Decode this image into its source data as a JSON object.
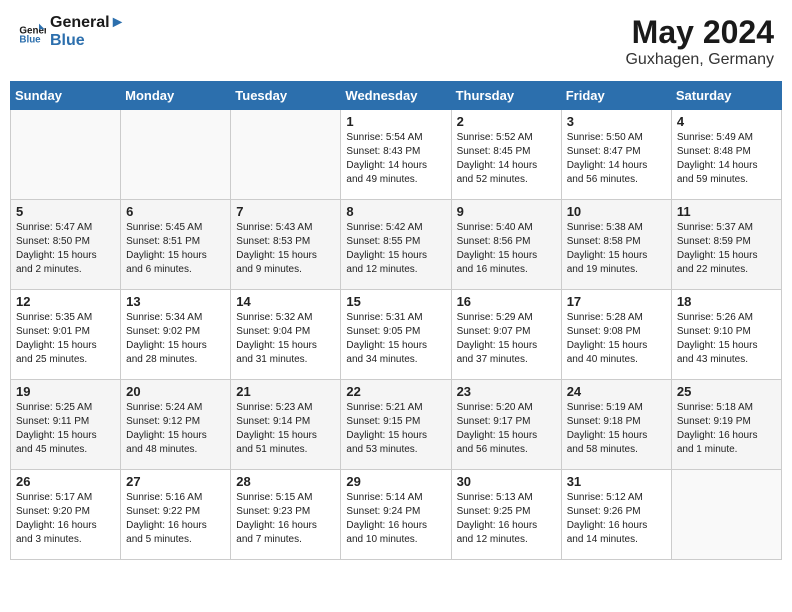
{
  "header": {
    "logo_line1": "General",
    "logo_line2": "Blue",
    "month": "May 2024",
    "location": "Guxhagen, Germany"
  },
  "weekdays": [
    "Sunday",
    "Monday",
    "Tuesday",
    "Wednesday",
    "Thursday",
    "Friday",
    "Saturday"
  ],
  "weeks": [
    [
      {
        "day": "",
        "sunrise": "",
        "sunset": "",
        "daylight": ""
      },
      {
        "day": "",
        "sunrise": "",
        "sunset": "",
        "daylight": ""
      },
      {
        "day": "",
        "sunrise": "",
        "sunset": "",
        "daylight": ""
      },
      {
        "day": "1",
        "sunrise": "Sunrise: 5:54 AM",
        "sunset": "Sunset: 8:43 PM",
        "daylight": "Daylight: 14 hours and 49 minutes."
      },
      {
        "day": "2",
        "sunrise": "Sunrise: 5:52 AM",
        "sunset": "Sunset: 8:45 PM",
        "daylight": "Daylight: 14 hours and 52 minutes."
      },
      {
        "day": "3",
        "sunrise": "Sunrise: 5:50 AM",
        "sunset": "Sunset: 8:47 PM",
        "daylight": "Daylight: 14 hours and 56 minutes."
      },
      {
        "day": "4",
        "sunrise": "Sunrise: 5:49 AM",
        "sunset": "Sunset: 8:48 PM",
        "daylight": "Daylight: 14 hours and 59 minutes."
      }
    ],
    [
      {
        "day": "5",
        "sunrise": "Sunrise: 5:47 AM",
        "sunset": "Sunset: 8:50 PM",
        "daylight": "Daylight: 15 hours and 2 minutes."
      },
      {
        "day": "6",
        "sunrise": "Sunrise: 5:45 AM",
        "sunset": "Sunset: 8:51 PM",
        "daylight": "Daylight: 15 hours and 6 minutes."
      },
      {
        "day": "7",
        "sunrise": "Sunrise: 5:43 AM",
        "sunset": "Sunset: 8:53 PM",
        "daylight": "Daylight: 15 hours and 9 minutes."
      },
      {
        "day": "8",
        "sunrise": "Sunrise: 5:42 AM",
        "sunset": "Sunset: 8:55 PM",
        "daylight": "Daylight: 15 hours and 12 minutes."
      },
      {
        "day": "9",
        "sunrise": "Sunrise: 5:40 AM",
        "sunset": "Sunset: 8:56 PM",
        "daylight": "Daylight: 15 hours and 16 minutes."
      },
      {
        "day": "10",
        "sunrise": "Sunrise: 5:38 AM",
        "sunset": "Sunset: 8:58 PM",
        "daylight": "Daylight: 15 hours and 19 minutes."
      },
      {
        "day": "11",
        "sunrise": "Sunrise: 5:37 AM",
        "sunset": "Sunset: 8:59 PM",
        "daylight": "Daylight: 15 hours and 22 minutes."
      }
    ],
    [
      {
        "day": "12",
        "sunrise": "Sunrise: 5:35 AM",
        "sunset": "Sunset: 9:01 PM",
        "daylight": "Daylight: 15 hours and 25 minutes."
      },
      {
        "day": "13",
        "sunrise": "Sunrise: 5:34 AM",
        "sunset": "Sunset: 9:02 PM",
        "daylight": "Daylight: 15 hours and 28 minutes."
      },
      {
        "day": "14",
        "sunrise": "Sunrise: 5:32 AM",
        "sunset": "Sunset: 9:04 PM",
        "daylight": "Daylight: 15 hours and 31 minutes."
      },
      {
        "day": "15",
        "sunrise": "Sunrise: 5:31 AM",
        "sunset": "Sunset: 9:05 PM",
        "daylight": "Daylight: 15 hours and 34 minutes."
      },
      {
        "day": "16",
        "sunrise": "Sunrise: 5:29 AM",
        "sunset": "Sunset: 9:07 PM",
        "daylight": "Daylight: 15 hours and 37 minutes."
      },
      {
        "day": "17",
        "sunrise": "Sunrise: 5:28 AM",
        "sunset": "Sunset: 9:08 PM",
        "daylight": "Daylight: 15 hours and 40 minutes."
      },
      {
        "day": "18",
        "sunrise": "Sunrise: 5:26 AM",
        "sunset": "Sunset: 9:10 PM",
        "daylight": "Daylight: 15 hours and 43 minutes."
      }
    ],
    [
      {
        "day": "19",
        "sunrise": "Sunrise: 5:25 AM",
        "sunset": "Sunset: 9:11 PM",
        "daylight": "Daylight: 15 hours and 45 minutes."
      },
      {
        "day": "20",
        "sunrise": "Sunrise: 5:24 AM",
        "sunset": "Sunset: 9:12 PM",
        "daylight": "Daylight: 15 hours and 48 minutes."
      },
      {
        "day": "21",
        "sunrise": "Sunrise: 5:23 AM",
        "sunset": "Sunset: 9:14 PM",
        "daylight": "Daylight: 15 hours and 51 minutes."
      },
      {
        "day": "22",
        "sunrise": "Sunrise: 5:21 AM",
        "sunset": "Sunset: 9:15 PM",
        "daylight": "Daylight: 15 hours and 53 minutes."
      },
      {
        "day": "23",
        "sunrise": "Sunrise: 5:20 AM",
        "sunset": "Sunset: 9:17 PM",
        "daylight": "Daylight: 15 hours and 56 minutes."
      },
      {
        "day": "24",
        "sunrise": "Sunrise: 5:19 AM",
        "sunset": "Sunset: 9:18 PM",
        "daylight": "Daylight: 15 hours and 58 minutes."
      },
      {
        "day": "25",
        "sunrise": "Sunrise: 5:18 AM",
        "sunset": "Sunset: 9:19 PM",
        "daylight": "Daylight: 16 hours and 1 minute."
      }
    ],
    [
      {
        "day": "26",
        "sunrise": "Sunrise: 5:17 AM",
        "sunset": "Sunset: 9:20 PM",
        "daylight": "Daylight: 16 hours and 3 minutes."
      },
      {
        "day": "27",
        "sunrise": "Sunrise: 5:16 AM",
        "sunset": "Sunset: 9:22 PM",
        "daylight": "Daylight: 16 hours and 5 minutes."
      },
      {
        "day": "28",
        "sunrise": "Sunrise: 5:15 AM",
        "sunset": "Sunset: 9:23 PM",
        "daylight": "Daylight: 16 hours and 7 minutes."
      },
      {
        "day": "29",
        "sunrise": "Sunrise: 5:14 AM",
        "sunset": "Sunset: 9:24 PM",
        "daylight": "Daylight: 16 hours and 10 minutes."
      },
      {
        "day": "30",
        "sunrise": "Sunrise: 5:13 AM",
        "sunset": "Sunset: 9:25 PM",
        "daylight": "Daylight: 16 hours and 12 minutes."
      },
      {
        "day": "31",
        "sunrise": "Sunrise: 5:12 AM",
        "sunset": "Sunset: 9:26 PM",
        "daylight": "Daylight: 16 hours and 14 minutes."
      },
      {
        "day": "",
        "sunrise": "",
        "sunset": "",
        "daylight": ""
      }
    ]
  ]
}
